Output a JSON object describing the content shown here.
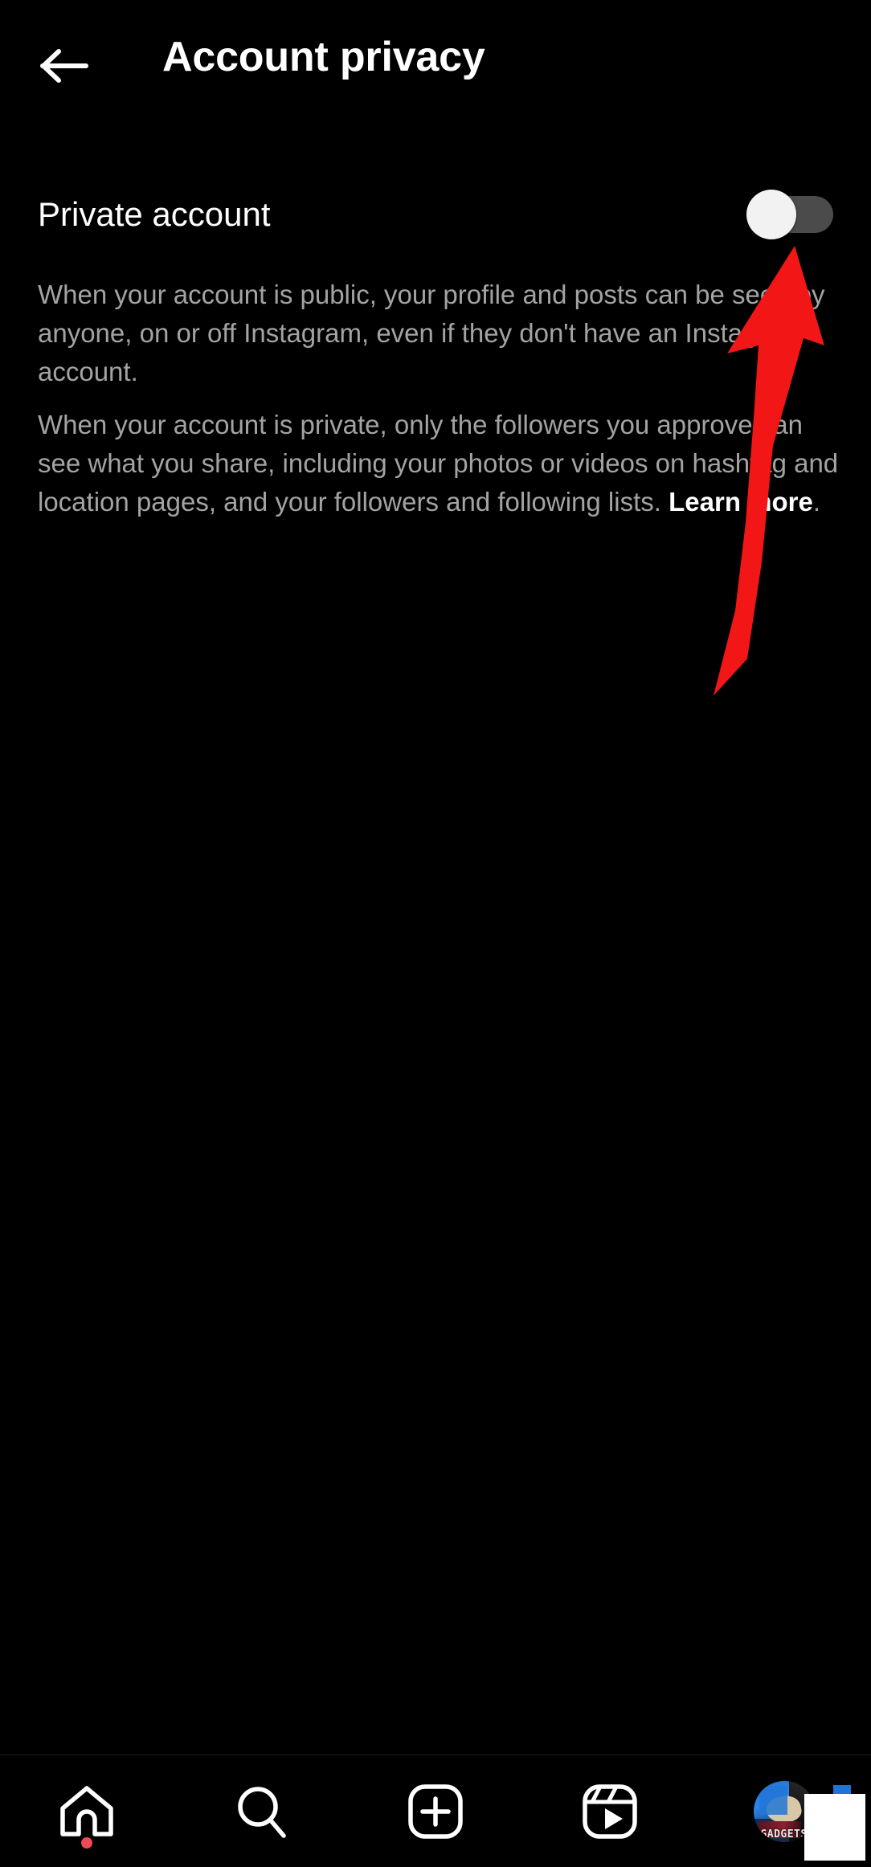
{
  "app": {
    "screen_name": "Account privacy",
    "theme": "dark",
    "background_color": "#000000"
  },
  "header": {
    "back_icon": "arrow-left-icon",
    "title": "Account privacy"
  },
  "setting": {
    "label": "Private account",
    "toggle": {
      "state": "off",
      "state_label": "Off",
      "knob_color": "#f2f2f2",
      "track_color": "#4b4b4b"
    }
  },
  "descriptions": {
    "paragraph_1": "When your account is public, your profile and posts can be seen by anyone, on or off Instagram, even if they don't have an Instagram account.",
    "paragraph_2_before_link": "When your account is private, only the followers you approve can see what you share, including your photos or videos on hashtag and location pages, and your followers and following lists. ",
    "paragraph_2_link": "Learn more",
    "paragraph_2_after_link": ".",
    "text_color": "#a3a3a3",
    "link_color": "#ffffff"
  },
  "annotation": {
    "type": "arrow",
    "color": "#f21616",
    "points_to": "private-account-toggle",
    "direction": "up"
  },
  "bottom_nav": {
    "items": [
      {
        "name": "home",
        "icon": "home-icon",
        "has_badge": true,
        "badge_color": "#ed4956"
      },
      {
        "name": "search",
        "icon": "search-icon",
        "has_badge": false
      },
      {
        "name": "create",
        "icon": "plus-square-icon",
        "has_badge": false
      },
      {
        "name": "reels",
        "icon": "reels-icon",
        "has_badge": false
      },
      {
        "name": "profile",
        "icon": "avatar-icon",
        "has_badge": false,
        "avatar_label": "GADGETS"
      }
    ]
  },
  "overlays": {
    "white_rect": "redaction-rectangle",
    "blue_square": "blue-square-mark"
  }
}
